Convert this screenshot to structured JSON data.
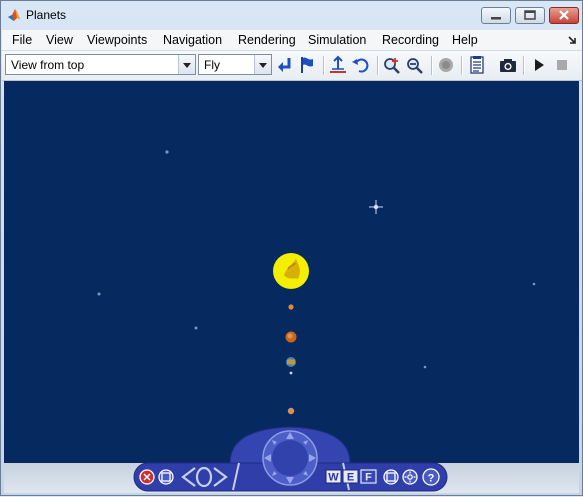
{
  "window": {
    "title": "Planets",
    "app_icon": "matlab-logo-icon",
    "controls": [
      "minimize-icon",
      "maximize-icon",
      "close-icon"
    ]
  },
  "menu": {
    "items": [
      "File",
      "View",
      "Viewpoints",
      "Navigation",
      "Rendering",
      "Simulation",
      "Recording",
      "Help"
    ],
    "dock_arrow": "dock-arrow-icon"
  },
  "toolbar": {
    "viewpoint_select": "View from top",
    "navigation_select": "Fly",
    "buttons": [
      "return-to-viewpoint-icon",
      "create-viewpoint-icon",
      "straighten-icon",
      "undo-move-icon",
      "zoom-in-icon",
      "zoom-out-icon",
      "stop-icon",
      "permalink-icon",
      "snapshot-icon",
      "play-icon",
      "stop-simulation-icon"
    ]
  },
  "scene": {
    "background": "#062a5f",
    "sun_color": "#f2ee00",
    "objects": [
      "sun",
      "mercury",
      "venus",
      "earth",
      "moon",
      "mars"
    ]
  },
  "nav_panel": {
    "buttons": [
      "close-panel-icon",
      "panel-options-icon",
      "slide-left-icon",
      "rotate-icon",
      "slide-right-icon",
      "navigation-wheel-icon",
      "walk-mode-icon",
      "examine-mode-icon",
      "fly-mode-icon",
      "straighten-icon",
      "headlight-icon",
      "help-icon"
    ],
    "mode_labels": [
      "W",
      "E",
      "F"
    ]
  }
}
